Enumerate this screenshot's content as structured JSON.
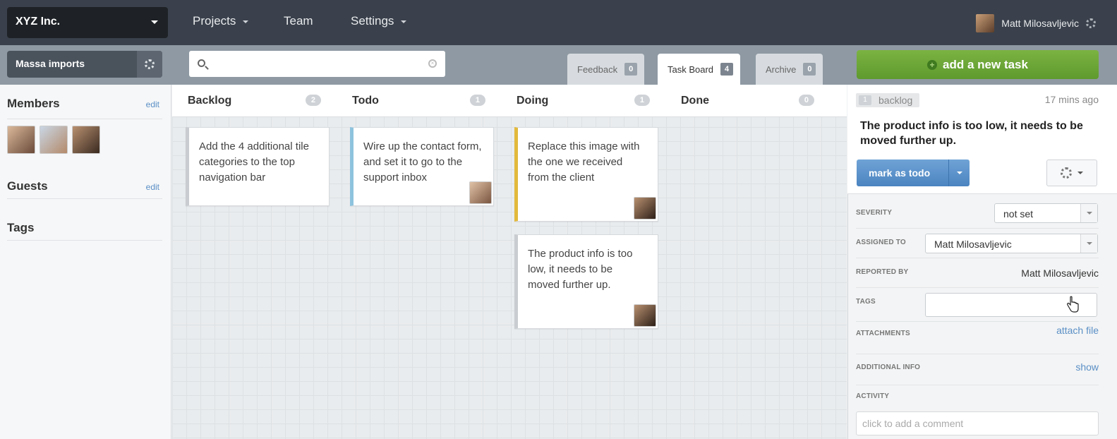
{
  "topbar": {
    "org": "XYZ Inc.",
    "nav": [
      "Projects",
      "Team",
      "Settings"
    ],
    "user": "Matt Milosavljevic"
  },
  "project": "Massa imports",
  "search": {
    "value": "",
    "placeholder": ""
  },
  "tabs": [
    {
      "label": "Feedback",
      "count": "0"
    },
    {
      "label": "Task Board",
      "count": "4"
    },
    {
      "label": "Archive",
      "count": "0"
    }
  ],
  "add_task": "add a new task",
  "sidebar": {
    "members_title": "Members",
    "guests_title": "Guests",
    "tags_title": "Tags",
    "edit": "edit"
  },
  "columns": [
    {
      "title": "Backlog",
      "count": "2"
    },
    {
      "title": "Todo",
      "count": "1"
    },
    {
      "title": "Doing",
      "count": "1"
    },
    {
      "title": "Done",
      "count": "0"
    }
  ],
  "cards": {
    "backlog": "Add the 4 additional tile categories to the top navigation bar",
    "todo": "Wire up the contact form, and set it to go to the support inbox",
    "doing1": "Replace this image with the one we received from the client",
    "doing2": "The product info is too low, it needs to be moved further up."
  },
  "detail": {
    "status_num": "1",
    "status": "backlog",
    "time_ago": "17 mins ago",
    "title": "The product info is too low, it needs to be moved further up.",
    "mark_button": "mark as todo",
    "severity_label": "SEVERITY",
    "severity_value": "not set",
    "assigned_label": "ASSIGNED TO",
    "assigned_value": "Matt Milosavljevic",
    "reported_label": "REPORTED BY",
    "reported_value": "Matt Milosavljevic",
    "tags_label": "TAGS",
    "attachments_label": "ATTACHMENTS",
    "attach_link": "attach file",
    "additional_label": "ADDITIONAL INFO",
    "show_link": "show",
    "activity_label": "ACTIVITY",
    "comment_placeholder": "click to add a comment"
  },
  "colors": {
    "topbar": "#3a414c",
    "green_button": "#6aa738",
    "blue_button": "#5a8fc6",
    "todo_card_accent": "#8ec3de",
    "doing_card_accent": "#e2b93b"
  }
}
